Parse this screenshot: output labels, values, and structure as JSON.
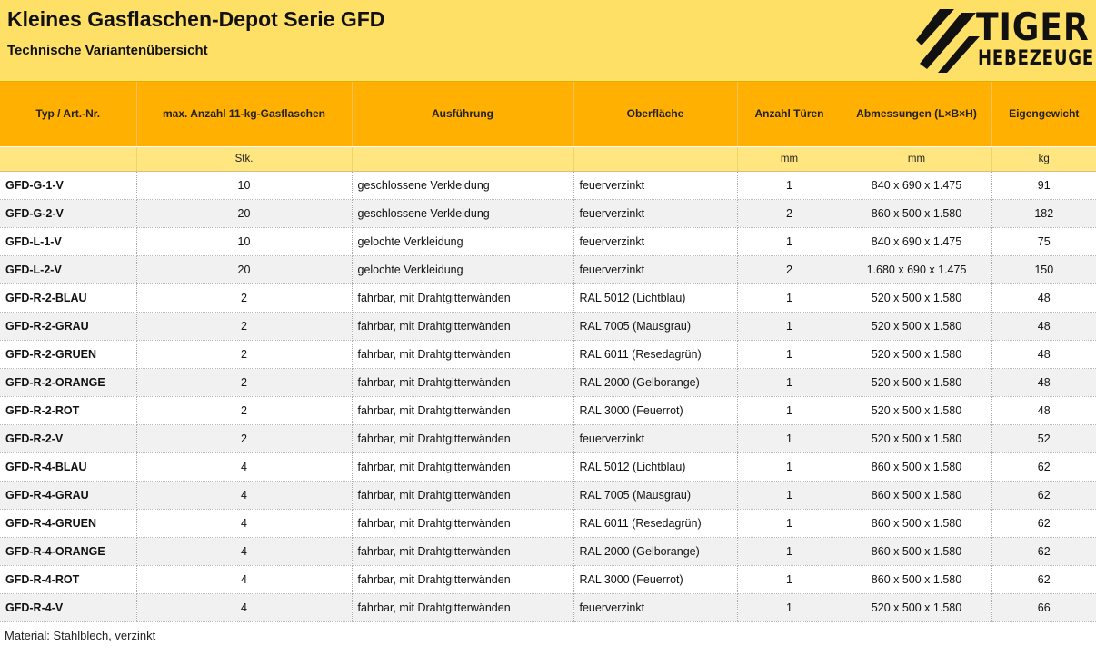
{
  "header": {
    "title": "Kleines Gasflaschen-Depot Serie GFD",
    "subtitle": "Technische Variantenübersicht",
    "logo": {
      "line1": "TIGER",
      "line2": "HEBEZEUGE",
      "icon": "tiger-claw-stripes-icon",
      "color": "#111111"
    }
  },
  "colors": {
    "header_bg": "#ffe066",
    "column_header_bg": "#ffb000",
    "unit_row_bg": "#ffe680",
    "row_alt_bg": "#f1f1f1"
  },
  "table": {
    "columns": [
      {
        "label": "Typ / Art.-Nr.",
        "unit": ""
      },
      {
        "label": "max. Anzahl 11-kg-Gasflaschen",
        "unit": "Stk."
      },
      {
        "label": "Ausführung",
        "unit": ""
      },
      {
        "label": "Oberfläche",
        "unit": ""
      },
      {
        "label": "Anzahl Türen",
        "unit": "mm"
      },
      {
        "label": "Abmessungen (L×B×H)",
        "unit": "mm"
      },
      {
        "label": "Eigengewicht",
        "unit": "kg"
      }
    ],
    "rows": [
      [
        "GFD-G-1-V",
        "10",
        "geschlossene Verkleidung",
        "feuerverzinkt",
        "1",
        "840 x 690 x 1.475",
        "91"
      ],
      [
        "GFD-G-2-V",
        "20",
        "geschlossene Verkleidung",
        "feuerverzinkt",
        "2",
        "860 x 500 x 1.580",
        "182"
      ],
      [
        "GFD-L-1-V",
        "10",
        "gelochte Verkleidung",
        "feuerverzinkt",
        "1",
        "840 x 690 x 1.475",
        "75"
      ],
      [
        "GFD-L-2-V",
        "20",
        "gelochte Verkleidung",
        "feuerverzinkt",
        "2",
        "1.680 x 690 x 1.475",
        "150"
      ],
      [
        "GFD-R-2-BLAU",
        "2",
        "fahrbar, mit Drahtgitterwänden",
        "RAL 5012 (Lichtblau)",
        "1",
        "520 x 500 x 1.580",
        "48"
      ],
      [
        "GFD-R-2-GRAU",
        "2",
        "fahrbar, mit Drahtgitterwänden",
        "RAL 7005 (Mausgrau)",
        "1",
        "520 x 500 x 1.580",
        "48"
      ],
      [
        "GFD-R-2-GRUEN",
        "2",
        "fahrbar, mit Drahtgitterwänden",
        "RAL 6011 (Resedagrün)",
        "1",
        "520 x 500 x 1.580",
        "48"
      ],
      [
        "GFD-R-2-ORANGE",
        "2",
        "fahrbar, mit Drahtgitterwänden",
        "RAL 2000 (Gelborange)",
        "1",
        "520 x 500 x 1.580",
        "48"
      ],
      [
        "GFD-R-2-ROT",
        "2",
        "fahrbar, mit Drahtgitterwänden",
        "RAL 3000 (Feuerrot)",
        "1",
        "520 x 500 x 1.580",
        "48"
      ],
      [
        "GFD-R-2-V",
        "2",
        "fahrbar, mit Drahtgitterwänden",
        "feuerverzinkt",
        "1",
        "520 x 500 x 1.580",
        "52"
      ],
      [
        "GFD-R-4-BLAU",
        "4",
        "fahrbar, mit Drahtgitterwänden",
        "RAL 5012 (Lichtblau)",
        "1",
        "860 x 500 x 1.580",
        "62"
      ],
      [
        "GFD-R-4-GRAU",
        "4",
        "fahrbar, mit Drahtgitterwänden",
        "RAL 7005 (Mausgrau)",
        "1",
        "860 x 500 x 1.580",
        "62"
      ],
      [
        "GFD-R-4-GRUEN",
        "4",
        "fahrbar, mit Drahtgitterwänden",
        "RAL 6011 (Resedagrün)",
        "1",
        "860 x 500 x 1.580",
        "62"
      ],
      [
        "GFD-R-4-ORANGE",
        "4",
        "fahrbar, mit Drahtgitterwänden",
        "RAL 2000 (Gelborange)",
        "1",
        "860 x 500 x 1.580",
        "62"
      ],
      [
        "GFD-R-4-ROT",
        "4",
        "fahrbar, mit Drahtgitterwänden",
        "RAL 3000 (Feuerrot)",
        "1",
        "860 x 500 x 1.580",
        "62"
      ],
      [
        "GFD-R-4-V",
        "4",
        "fahrbar, mit Drahtgitterwänden",
        "feuerverzinkt",
        "1",
        "520 x 500 x 1.580",
        "66"
      ]
    ]
  },
  "footnote": "Material: Stahlblech, verzinkt"
}
